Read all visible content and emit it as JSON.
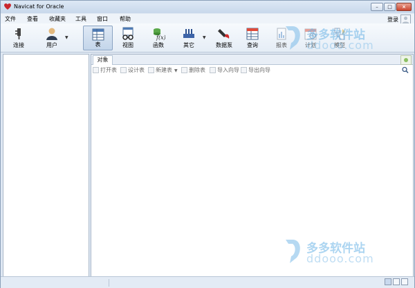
{
  "window": {
    "title": "Navicat for Oracle",
    "controls": {
      "minimize": "–",
      "maximize": "□",
      "close": "×"
    }
  },
  "menu": {
    "items": [
      "文件",
      "查看",
      "收藏夹",
      "工具",
      "窗口",
      "帮助"
    ],
    "login": "登录"
  },
  "toolbar": {
    "items": [
      {
        "label": "连接",
        "icon": "plug-icon"
      },
      {
        "label": "用户",
        "icon": "user-icon"
      },
      {
        "label": "表",
        "icon": "table-icon",
        "active": true
      },
      {
        "label": "视图",
        "icon": "view-icon"
      },
      {
        "label": "函数",
        "icon": "function-icon"
      },
      {
        "label": "其它",
        "icon": "tools-icon"
      },
      {
        "label": "数据泵",
        "icon": "data-pump-icon"
      },
      {
        "label": "查询",
        "icon": "query-icon"
      },
      {
        "label": "报表",
        "icon": "report-icon",
        "disabled": true
      },
      {
        "label": "计划",
        "icon": "schedule-icon",
        "disabled": true
      },
      {
        "label": "模型",
        "icon": "model-icon",
        "disabled": true
      }
    ]
  },
  "tabs": {
    "object_label": "对象"
  },
  "actions": [
    {
      "label": "打开表"
    },
    {
      "label": "设计表"
    },
    {
      "label": "新建表"
    },
    {
      "label": "删除表"
    },
    {
      "label": "导入向导"
    },
    {
      "label": "导出向导"
    }
  ],
  "watermark": {
    "cn": "多多软件站",
    "en": "ddooo.com"
  },
  "colors": {
    "accent": "#c8d8eb",
    "selected_tool": "#c3d5ea",
    "watermark": "#6ab3e6"
  }
}
